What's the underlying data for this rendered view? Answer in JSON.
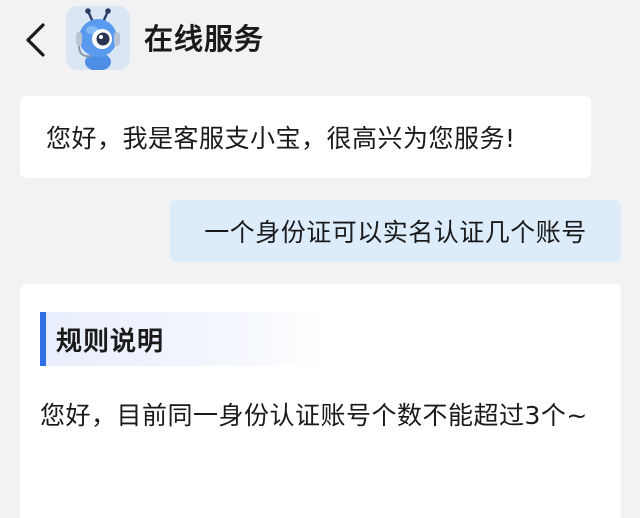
{
  "header": {
    "title": "在线服务",
    "back_icon": "chevron-left-icon",
    "avatar_icon": "robot-mascot-icon"
  },
  "messages": {
    "bot_greeting": "您好，我是客服支小宝，很高兴为您服务!",
    "user_question": "一个身份证可以实名认证几个账号",
    "answer": {
      "section_title": "规则说明",
      "body": "您好，目前同一身份认证账号个数不能超过3个~"
    }
  },
  "colors": {
    "background": "#f2f2f4",
    "bubble_bot": "#ffffff",
    "bubble_user": "#dcecfb",
    "accent": "#2f6fe4"
  }
}
